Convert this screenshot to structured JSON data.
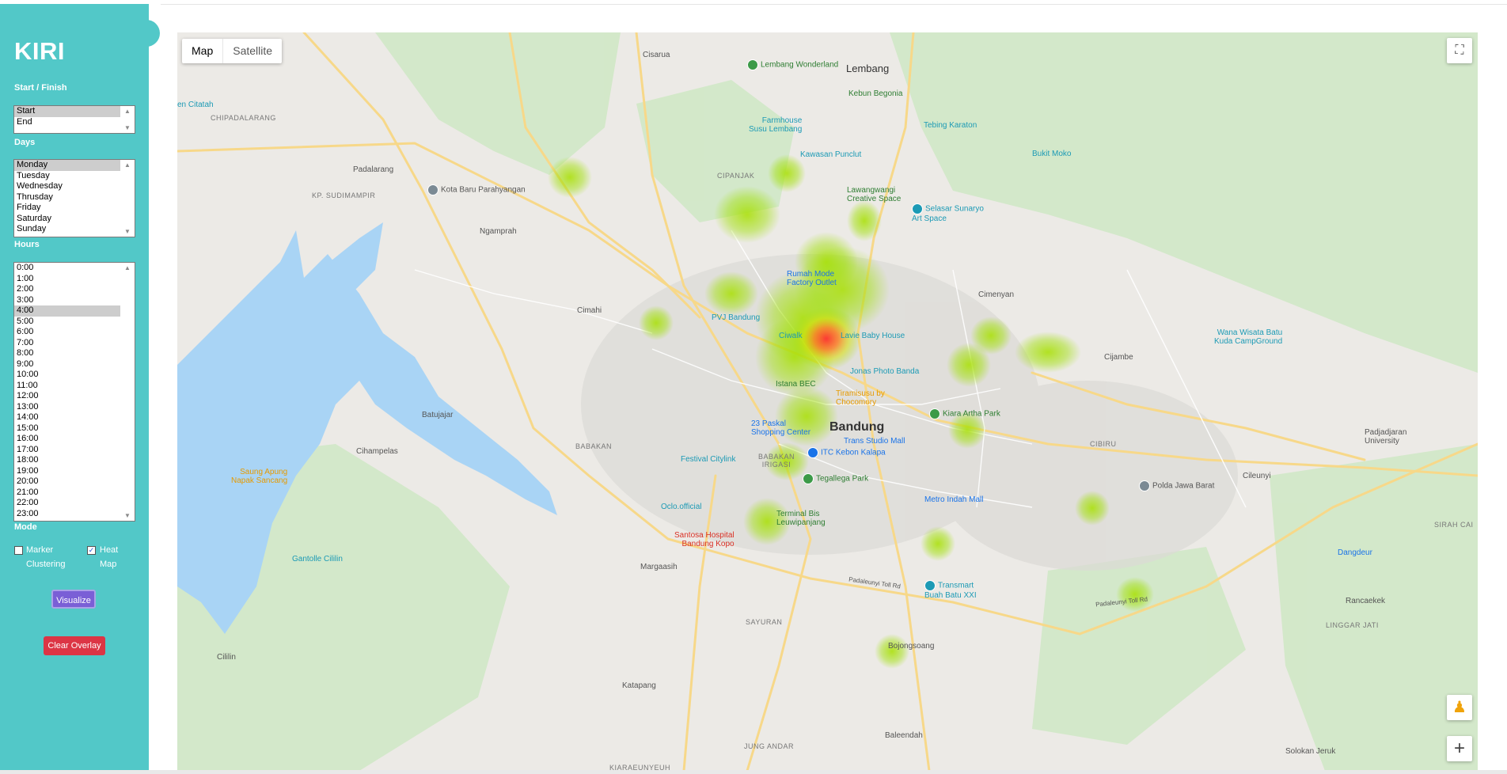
{
  "sidebar": {
    "brand": "KIRI",
    "start_finish": {
      "label": "Start / Finish",
      "options": [
        "Start",
        "End"
      ],
      "selected": "Start"
    },
    "days": {
      "label": "Days",
      "options": [
        "Monday",
        "Tuesday",
        "Wednesday",
        "Thrusday",
        "Friday",
        "Saturday",
        "Sunday"
      ],
      "selected": "Monday"
    },
    "hours": {
      "label": "Hours",
      "options": [
        "0:00",
        "1:00",
        "2:00",
        "3:00",
        "4:00",
        "5:00",
        "6:00",
        "7:00",
        "8:00",
        "9:00",
        "10:00",
        "11:00",
        "12:00",
        "13:00",
        "14:00",
        "15:00",
        "16:00",
        "17:00",
        "18:00",
        "19:00",
        "20:00",
        "21:00",
        "22:00",
        "23:00"
      ],
      "selected": "4:00"
    },
    "mode": {
      "label": "Mode",
      "marker_line1": "Marker",
      "marker_line2": "Clustering",
      "marker_checked": false,
      "heat_line1": "Heat",
      "heat_line2": "Map",
      "heat_checked": true
    },
    "visualize_label": "Visualize",
    "clear_label": "Clear Overlay"
  },
  "map": {
    "type_active": "Map",
    "type_other": "Satellite",
    "fullscreen_icon": "fullscreen-icon",
    "pegman_icon": "pegman-icon",
    "zoom_in_icon": "+",
    "labels": {
      "cisarua": "Cisarua",
      "lembang": "Lembang",
      "lembang_wonderland": "Lembang Wonderland",
      "kebun_begonia": "Kebun Begonia",
      "citatah": "en Citatah",
      "chipadalarang": "CHIPADALARANG",
      "farmhouse": "Farmhouse\nSusu Lembang",
      "tebing_karaton": "Tebing Karaton",
      "bukit_moko": "Bukit Moko",
      "kawasan_punclut": "Kawasan Punclut",
      "cipanjak": "CIPANJAK",
      "padalarang": "Padalarang",
      "kota_baru": "Kota Baru Parahyangan",
      "sudimampir": "KP. SUDIMAMPIR",
      "lawangwangi": "Lawangwangi\nCreative Space",
      "selasar": "Selasar Sunaryo\nArt Space",
      "ngamprah": "Ngamprah",
      "rumah_mode": "Rumah Mode\nFactory Outlet",
      "cimenyan": "Cimenyan",
      "cimahi": "Cimahi",
      "pvj": "PVJ Bandung",
      "ciwalk": "Ciwalk",
      "lavie": "Lavie Baby House",
      "jonas": "Jonas Photo Banda",
      "wana_wisata": "Wana Wisata Batu\nKuda CampGround",
      "cijambe": "Cijambe",
      "istana_bec": "Istana BEC",
      "tiramisusu": "Tiramisusu by\nChocomory",
      "batujajar": "Batujajar",
      "kiara_artha": "Kiara Artha Park",
      "paskal": "23 Paskal\nShopping Center",
      "bandung": "Bandung",
      "padjadjaran": "Padjadjaran\nUniversity",
      "cihampelas": "Cihampelas",
      "babakan": "BABAKAN",
      "trans_studio": "Trans Studio Mall",
      "itc": "ITC Kebon Kalapa",
      "cibiru": "CIBIRU",
      "festival_citylink": "Festival Citylink",
      "babakan_irigasi": "BABAKAN\nIRIGASI",
      "saung_apung": "Saung Apung\nNapak Sancang",
      "tegallega": "Tegallega Park",
      "polda": "Polda Jawa Barat",
      "cileunyi": "Cileunyi",
      "metro_indah": "Metro Indah Mall",
      "oclo": "Oclo.official",
      "terminal": "Terminal Bis\nLeuwipanjang",
      "sirah_cai": "SIRAH CAI",
      "santosa": "Santosa Hospital\nBandung Kopo",
      "gantolle": "Gantolle Cililin",
      "margaasih": "Margaasih",
      "dangdeur": "Dangdeur",
      "transmart": "Transmart\nBuah Batu XXI",
      "rancaekek": "Rancaekek",
      "sayuran": "SAYURAN",
      "linggar_jati": "LINGGAR JATI",
      "bojongsoang": "Bojongsoang",
      "cililin": "Cililin",
      "katapang": "Katapang",
      "baleendah": "Baleendah",
      "jungandar": "JUNG ANDAR",
      "solokan": "Solokan Jeruk",
      "kiaraeunyeuh": "KIARAEUNYEUH",
      "pada_toll": "Padaleunyi Toll Rd",
      "pada_toll2": "Padaleunyi Toll Rd"
    }
  }
}
